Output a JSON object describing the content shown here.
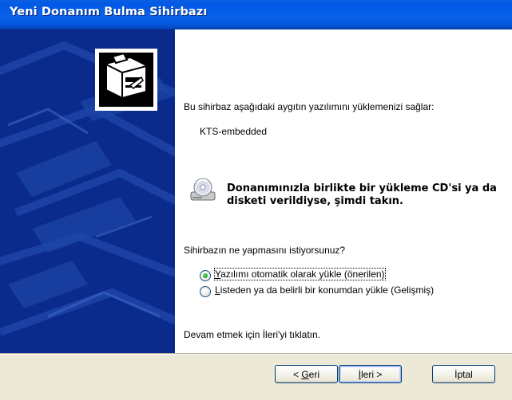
{
  "window": {
    "title": "Yeni Donanım Bulma Sihirbazı"
  },
  "content": {
    "intro": "Bu sihirbaz aşağıdaki aygıtın yazılımını yüklemenizi sağlar:",
    "device_name": "KTS-embedded",
    "cd_notice": "Donanımınızla birlikte bir yükleme CD'si ya da disketi verildiyse, şimdi takın.",
    "question": "Sihirbazın ne yapmasını istiyorsunuz?",
    "options": [
      {
        "prefix": "",
        "accel": "Y",
        "rest": "azılımı otomatik olarak yükle (önerilen)",
        "selected": true
      },
      {
        "prefix": "",
        "accel": "L",
        "rest": "isteden ya da belirli bir konumdan yükle (Gelişmiş)",
        "selected": false
      }
    ],
    "footer": "Devam etmek için İleri'yi tıklatın."
  },
  "buttons": {
    "back": {
      "prefix": "< ",
      "accel": "G",
      "rest": "eri"
    },
    "next": {
      "prefix": "",
      "accel": "İ",
      "rest": "leri >"
    },
    "cancel": {
      "label": "İptal"
    }
  },
  "icons": {
    "wizard": "hardware-wizard-icon",
    "cd": "cd-drive-icon"
  },
  "colors": {
    "titlebar": "#0058e6",
    "banner": "#0a2b8c",
    "radio_selected": "#21a121"
  }
}
